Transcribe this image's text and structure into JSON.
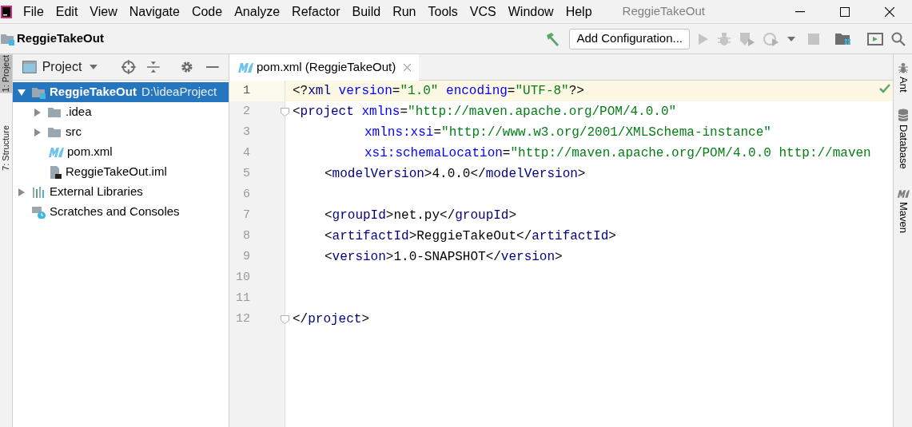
{
  "menu": [
    "File",
    "Edit",
    "View",
    "Navigate",
    "Code",
    "Analyze",
    "Refactor",
    "Build",
    "Run",
    "Tools",
    "VCS",
    "Window",
    "Help"
  ],
  "window": {
    "title": "ReggieTakeOut"
  },
  "breadcrumb": "ReggieTakeOut",
  "toolbar": {
    "run_config": "Add Configuration..."
  },
  "left_strip": [
    {
      "label": "1: Project",
      "selected": true
    },
    {
      "label": "7: Structure",
      "selected": false
    }
  ],
  "project_panel": {
    "title": "Project",
    "tree": [
      {
        "kind": "module",
        "label": "ReggieTakeOut",
        "path": "D:\\ideaProject",
        "expanded": true,
        "selected": true,
        "children": [
          {
            "kind": "folder",
            "label": ".idea",
            "expanded": false,
            "selected": false
          },
          {
            "kind": "folder",
            "label": "src",
            "expanded": false,
            "selected": false
          },
          {
            "kind": "maven",
            "label": "pom.xml",
            "selected": false
          },
          {
            "kind": "iml",
            "label": "ReggieTakeOut.iml",
            "selected": false
          }
        ]
      },
      {
        "kind": "libraries",
        "label": "External Libraries",
        "expanded": false,
        "selected": false
      },
      {
        "kind": "scratches",
        "label": "Scratches and Consoles",
        "selected": false
      }
    ]
  },
  "editor": {
    "tabs": [
      {
        "label": "pom.xml (ReggieTakeOut)",
        "selected": true
      }
    ],
    "lines": [
      {
        "number": "1",
        "kind": "root",
        "current": true,
        "fold": false,
        "tokens": [
          {
            "kind": "punct",
            "text": "<?"
          },
          {
            "kind": "tag",
            "text": "xml "
          },
          {
            "kind": "attr",
            "text": "version"
          },
          {
            "kind": "punct",
            "text": "="
          },
          {
            "kind": "value",
            "text": "\"1.0\" "
          },
          {
            "kind": "attr",
            "text": "encoding"
          },
          {
            "kind": "punct",
            "text": "="
          },
          {
            "kind": "value",
            "text": "\"UTF-8\""
          },
          {
            "kind": "punct",
            "text": "?>"
          }
        ]
      },
      {
        "number": "2",
        "kind": "root",
        "current": false,
        "fold": true,
        "tokens": [
          {
            "kind": "punct",
            "text": "<"
          },
          {
            "kind": "tag",
            "text": "project "
          },
          {
            "kind": "attr",
            "text": "xmlns"
          },
          {
            "kind": "punct",
            "text": "="
          },
          {
            "kind": "value",
            "text": "\"http://maven.apache.org/POM/4.0.0\""
          }
        ]
      },
      {
        "number": "3",
        "kind": "attribute",
        "current": false,
        "fold": false,
        "tokens": [
          {
            "kind": "attr",
            "text": "xmlns:xsi"
          },
          {
            "kind": "punct",
            "text": "="
          },
          {
            "kind": "value",
            "text": "\"http://www.w3.org/2001/XMLSchema-instance\""
          }
        ]
      },
      {
        "number": "4",
        "kind": "attribute",
        "current": false,
        "fold": false,
        "tokens": [
          {
            "kind": "attr",
            "text": "xsi:schemaLocation"
          },
          {
            "kind": "punct",
            "text": "="
          },
          {
            "kind": "value",
            "text": "\"http://maven.apache.org/POM/4.0.0 http://maven"
          }
        ]
      },
      {
        "number": "5",
        "kind": "child",
        "current": false,
        "fold": false,
        "tokens": [
          {
            "kind": "punct",
            "text": "<"
          },
          {
            "kind": "tag",
            "text": "modelVersion"
          },
          {
            "kind": "punct",
            "text": ">4.0.0</"
          },
          {
            "kind": "tag",
            "text": "modelVersion"
          },
          {
            "kind": "punct",
            "text": ">"
          }
        ]
      },
      {
        "number": "6",
        "kind": "blank",
        "current": false,
        "fold": false
      },
      {
        "number": "7",
        "kind": "child",
        "current": false,
        "fold": false,
        "tokens": [
          {
            "kind": "punct",
            "text": "<"
          },
          {
            "kind": "tag",
            "text": "groupId"
          },
          {
            "kind": "punct",
            "text": ">net.py</"
          },
          {
            "kind": "tag",
            "text": "groupId"
          },
          {
            "kind": "punct",
            "text": ">"
          }
        ]
      },
      {
        "number": "8",
        "kind": "child",
        "current": false,
        "fold": false,
        "tokens": [
          {
            "kind": "punct",
            "text": "<"
          },
          {
            "kind": "tag",
            "text": "artifactId"
          },
          {
            "kind": "punct",
            "text": ">ReggieTakeOut</"
          },
          {
            "kind": "tag",
            "text": "artifactId"
          },
          {
            "kind": "punct",
            "text": ">"
          }
        ]
      },
      {
        "number": "9",
        "kind": "child",
        "current": false,
        "fold": false,
        "tokens": [
          {
            "kind": "punct",
            "text": "<"
          },
          {
            "kind": "tag",
            "text": "version"
          },
          {
            "kind": "punct",
            "text": ">1.0-SNAPSHOT</"
          },
          {
            "kind": "tag",
            "text": "version"
          },
          {
            "kind": "punct",
            "text": ">"
          }
        ]
      },
      {
        "number": "10",
        "kind": "blank",
        "current": false,
        "fold": false
      },
      {
        "number": "11",
        "kind": "blank",
        "current": false,
        "fold": false
      },
      {
        "number": "12",
        "kind": "root",
        "current": false,
        "fold": true,
        "tokens": [
          {
            "kind": "punct",
            "text": "</"
          },
          {
            "kind": "tag",
            "text": "project"
          },
          {
            "kind": "punct",
            "text": ">"
          }
        ]
      }
    ]
  },
  "right_strip": [
    {
      "kind": "ant",
      "label": "Ant"
    },
    {
      "kind": "database",
      "label": "Database"
    },
    {
      "kind": "maven",
      "label": "Maven"
    }
  ]
}
